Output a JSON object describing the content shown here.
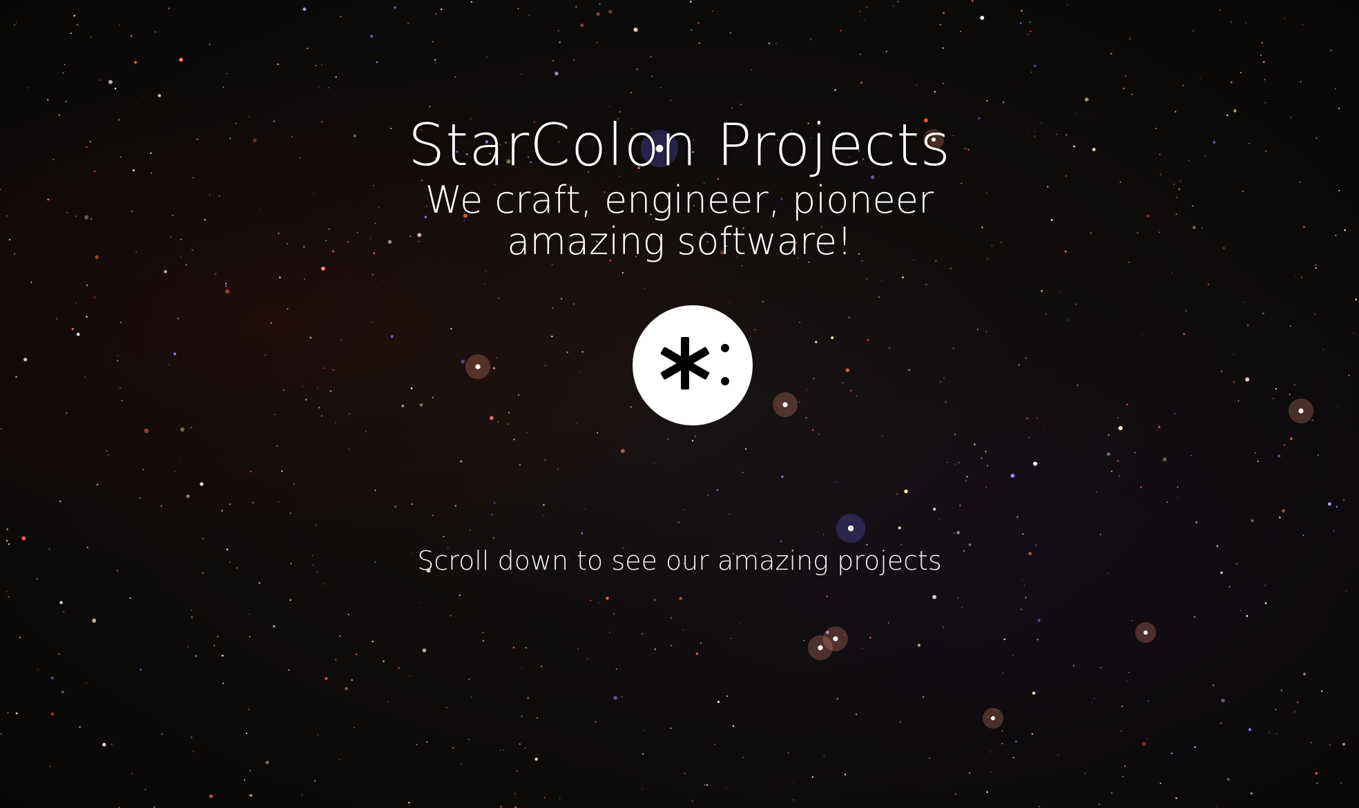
{
  "hero": {
    "title": "StarColon Projects",
    "tagline_line1": "We craft, engineer, pioneer",
    "tagline_line2": "amazing software!",
    "logo_icon": "asterisk-colon-logo-icon",
    "scroll_hint": "Scroll down to see our amazing projects",
    "background": "starfield"
  },
  "colors": {
    "text": "#ffffff",
    "background": "#0d0b0a",
    "logo_circle": "#ffffff",
    "logo_glyph": "#000000"
  }
}
